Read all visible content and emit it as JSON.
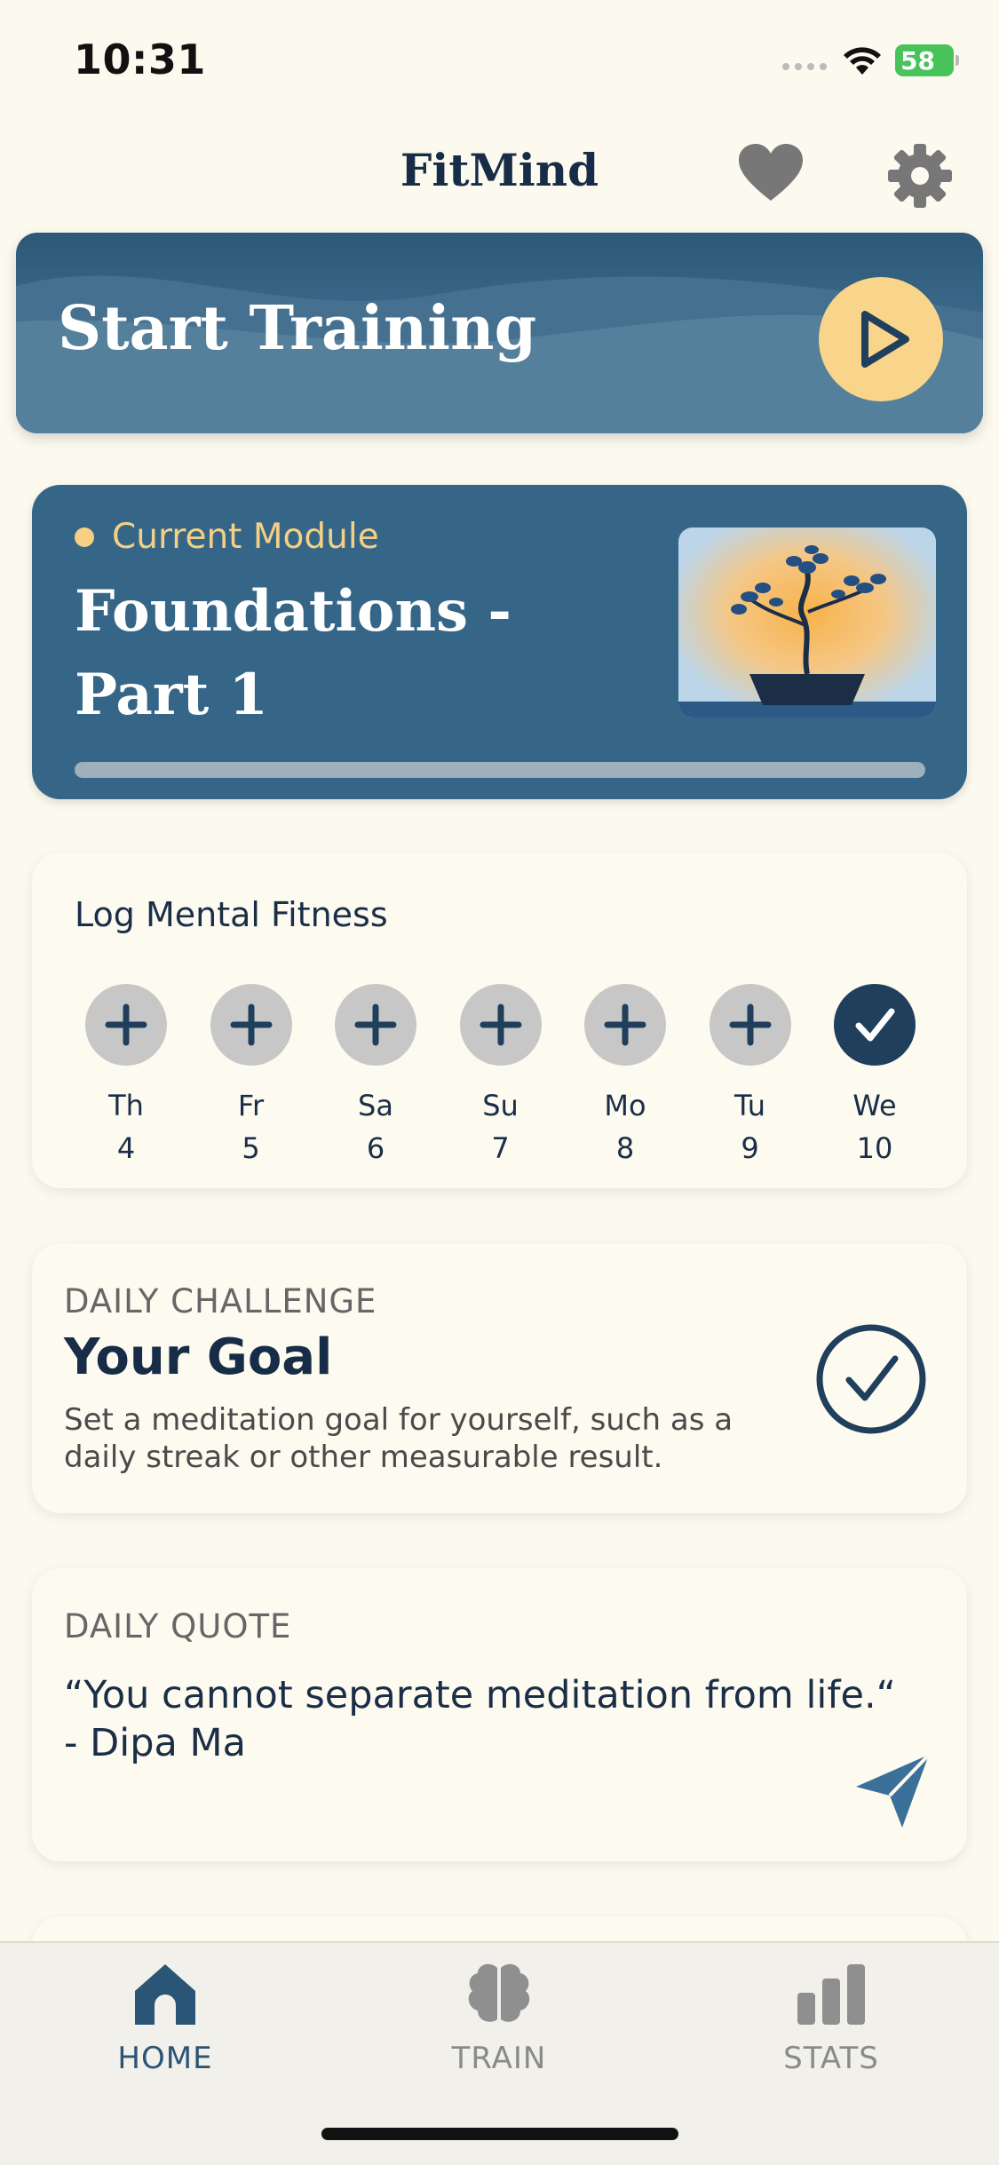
{
  "status_bar": {
    "time": "10:31",
    "battery": "58"
  },
  "header": {
    "title": "FitMind",
    "icons": [
      "heart-icon",
      "gear-icon"
    ]
  },
  "start_training": {
    "label": "Start Training",
    "icon": "play-icon"
  },
  "current_module": {
    "label": "Current Module",
    "title": "Foundations - Part 1",
    "image": "bonsai-tree-illustration"
  },
  "log": {
    "title": "Log Mental Fitness",
    "days": [
      {
        "name": "Th",
        "num": "4",
        "done": false
      },
      {
        "name": "Fr",
        "num": "5",
        "done": false
      },
      {
        "name": "Sa",
        "num": "6",
        "done": false
      },
      {
        "name": "Su",
        "num": "7",
        "done": false
      },
      {
        "name": "Mo",
        "num": "8",
        "done": false
      },
      {
        "name": "Tu",
        "num": "9",
        "done": false
      },
      {
        "name": "We",
        "num": "10",
        "done": true
      }
    ]
  },
  "challenge": {
    "eyebrow": "DAILY CHALLENGE",
    "title": "Your Goal",
    "description": "Set a meditation goal for yourself, such as a daily streak or other measurable result."
  },
  "quote": {
    "eyebrow": "DAILY QUOTE",
    "text": "“You cannot separate meditation from life.“ - Dipa Ma"
  },
  "tabs": [
    {
      "label": "HOME",
      "icon": "home-icon",
      "active": true
    },
    {
      "label": "TRAIN",
      "icon": "brain-icon",
      "active": false
    },
    {
      "label": "STATS",
      "icon": "bar-chart-icon",
      "active": false
    }
  ],
  "colors": {
    "primary": "#356687",
    "accent": "#f8d58a",
    "background": "#fcf9ee",
    "done": "#1f3f5c"
  }
}
